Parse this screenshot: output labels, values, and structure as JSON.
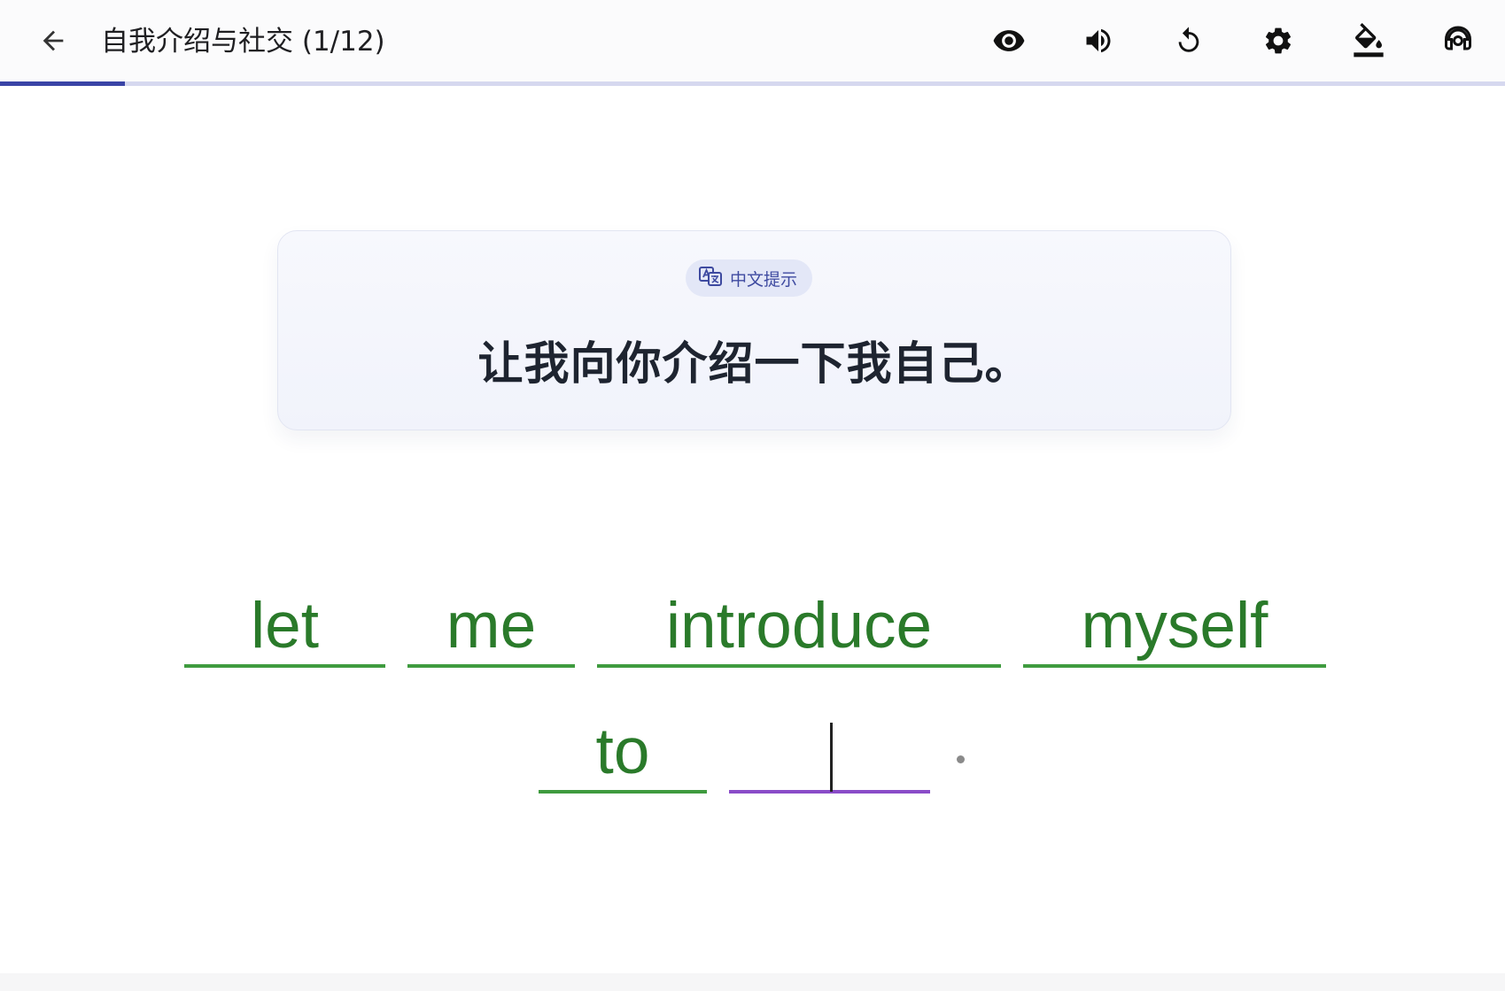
{
  "header": {
    "title": "自我介绍与社交 (1/12)",
    "progress_fraction": 0.083
  },
  "toolbar": {
    "icons": [
      "eye-icon",
      "volume-icon",
      "reset-icon",
      "settings-icon",
      "paint-bucket-icon",
      "headset-icon"
    ]
  },
  "hint": {
    "badge_label": "中文提示",
    "sentence": "让我向你介绍一下我自己。"
  },
  "answer": {
    "words": [
      "let",
      "me",
      "introduce",
      "myself",
      "to"
    ],
    "active_value": "",
    "punctuation": "."
  },
  "colors": {
    "accent": "#3a44a6",
    "correct": "#2a7a2a",
    "active_blank": "#8a4cc8"
  }
}
